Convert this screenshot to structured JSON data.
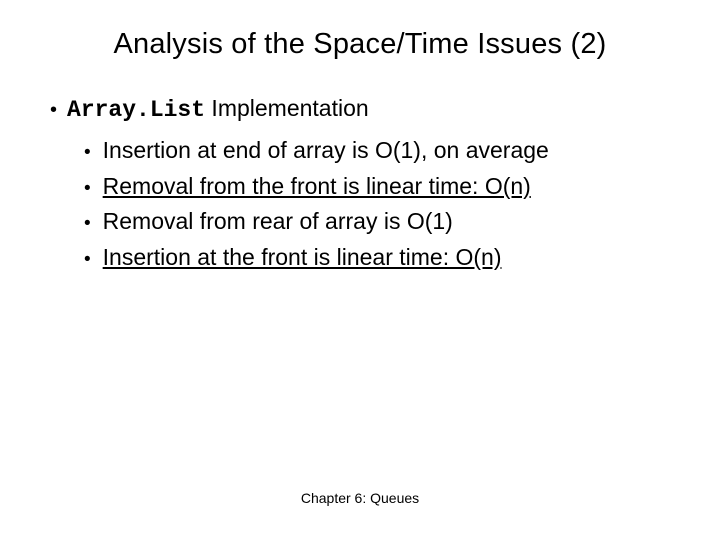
{
  "title": "Analysis of the Space/Time Issues (2)",
  "heading": {
    "mono": "Array.List",
    "rest": " Implementation"
  },
  "bullets": [
    {
      "text": "Insertion at end of array is O(1), on average",
      "underline": false
    },
    {
      "text": "Removal from the front is linear time: O(n)",
      "underline": true
    },
    {
      "text": "Removal from rear of array is O(1)",
      "underline": false
    },
    {
      "text": "Insertion at the front is linear time: O(n)",
      "underline": true
    }
  ],
  "footer": "Chapter 6: Queues"
}
